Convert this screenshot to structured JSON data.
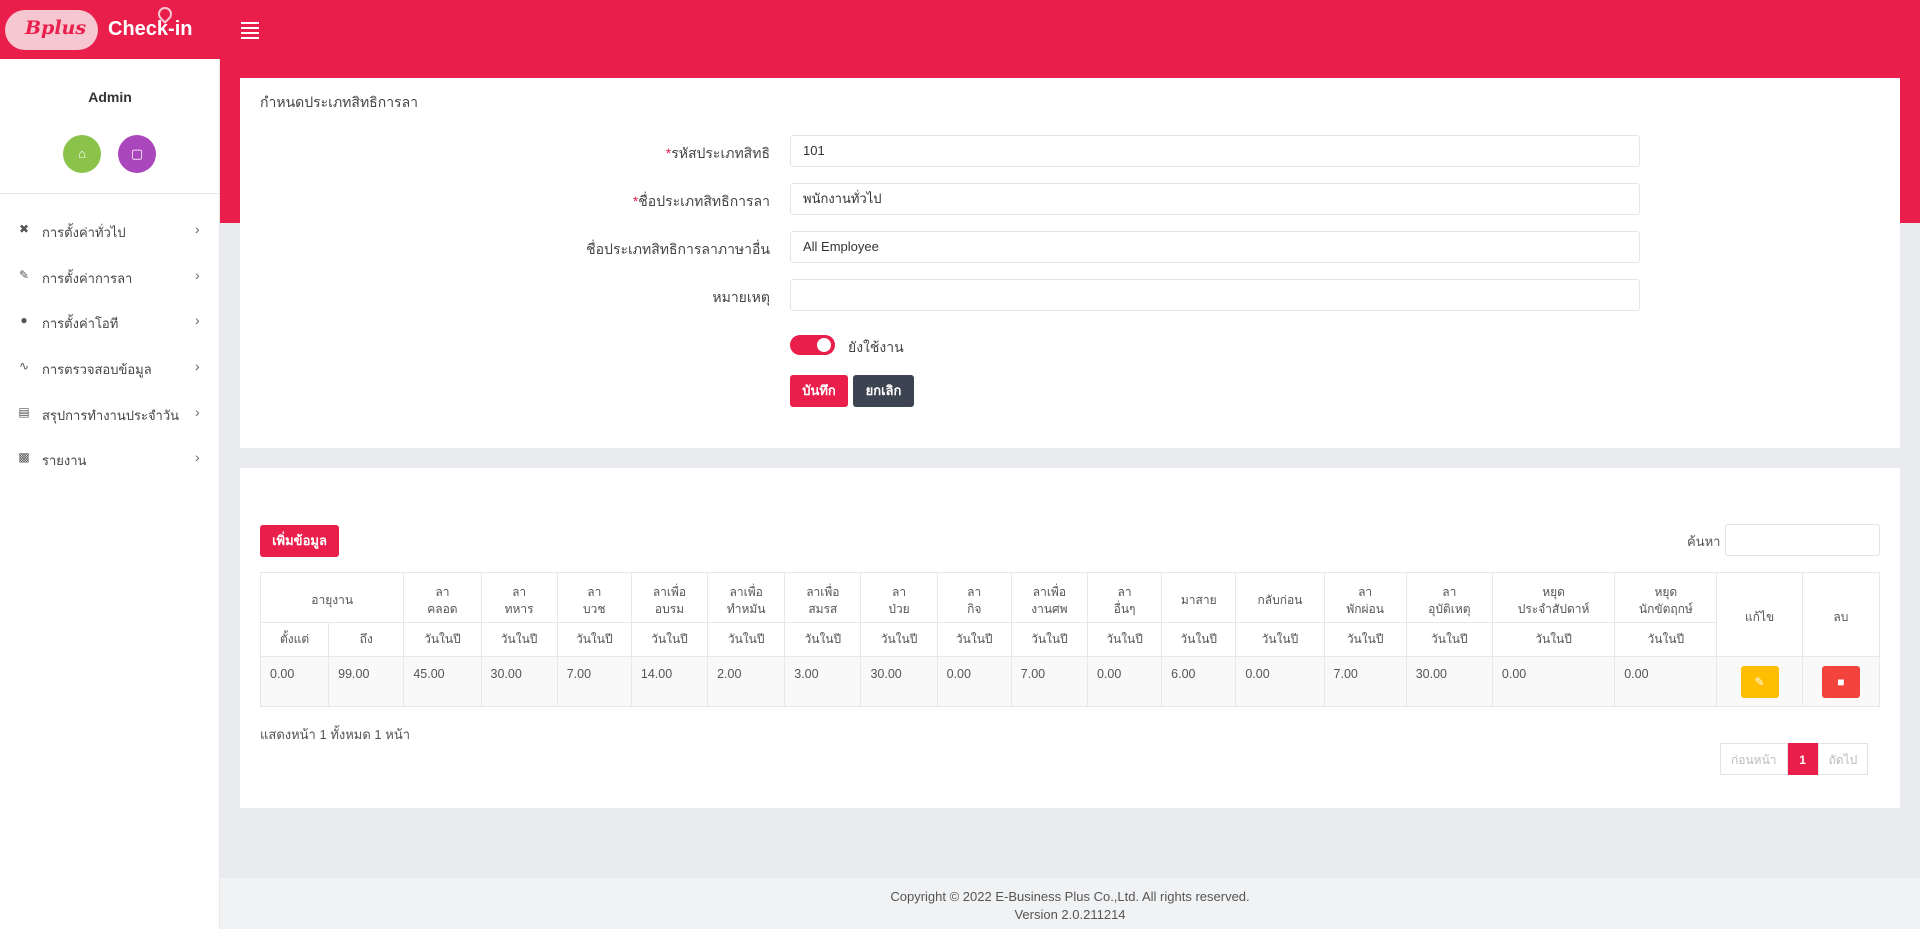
{
  "brand": {
    "logo_text": "Bplus",
    "app_name": "Check-in"
  },
  "user": {
    "name": "Admin"
  },
  "colors": {
    "primary": "#e91e4b",
    "dark": "#3d4451",
    "home": "#8bc34a",
    "lock": "#ab47bc",
    "edit": "#ffbe00",
    "delete": "#f4433c"
  },
  "sidebar": {
    "items": [
      {
        "label": "การตั้งค่าทั่วไป",
        "icon": "tools-icon"
      },
      {
        "label": "การตั้งค่าการลา",
        "icon": "edit-icon"
      },
      {
        "label": "การตั้งค่าโอที",
        "icon": "info-icon"
      },
      {
        "label": "การตรวจสอบข้อมูล",
        "icon": "pulse-icon"
      },
      {
        "label": "สรุปการทำงานประจำวัน",
        "icon": "list-icon"
      },
      {
        "label": "รายงาน",
        "icon": "document-icon"
      }
    ]
  },
  "form": {
    "title": "กำหนดประเภทสิทธิการลา",
    "code_label": "รหัสประเภทสิทธิ",
    "code_value": "101",
    "name_label": "ชื่อประเภทสิทธิการลา",
    "name_value": "พนักงานทั่วไป",
    "other_lang_label": "ชื่อประเภทสิทธิการลาภาษาอื่น",
    "other_lang_value": "All Employee",
    "remark_label": "หมายเหตุ",
    "remark_value": "",
    "active_label": "ยังใช้งาน",
    "save_label": "บันทึก",
    "cancel_label": "ยกเลิก"
  },
  "list": {
    "add_label": "เพิ่มข้อมูล",
    "search_label": "ค้นหา",
    "search_value": "",
    "headers_top": [
      "อายุงาน",
      "ลา\nคลอด",
      "ลา\nทหาร",
      "ลา\nบวช",
      "ลาเพื่อ\nอบรม",
      "ลาเพื่อ\nทำหมัน",
      "ลาเพื่อ\nสมรส",
      "ลา\nป่วย",
      "ลา\nกิจ",
      "ลาเพื่อ\nงานศพ",
      "ลา\nอื่นๆ",
      "มาสาย",
      "กลับก่อน",
      "ลา\nพักผ่อน",
      "ลา\nอุบัติเหตุ",
      "หยุด\nประจำสัปดาห์",
      "หยุด\nนักขัตฤกษ์",
      "แก้ไข",
      "ลบ"
    ],
    "headers_sub": [
      "ตั้งแต่",
      "ถึง",
      "วันในปี",
      "วันในปี",
      "วันในปี",
      "วันในปี",
      "วันในปี",
      "วันในปี",
      "วันในปี",
      "วันในปี",
      "วันในปี",
      "วันในปี",
      "วันในปี",
      "วันในปี",
      "วันในปี",
      "วันในปี",
      "วันในปี",
      "วันในปี"
    ],
    "rows": [
      [
        "0.00",
        "99.00",
        "45.00",
        "30.00",
        "7.00",
        "14.00",
        "2.00",
        "3.00",
        "30.00",
        "0.00",
        "7.00",
        "0.00",
        "6.00",
        "0.00",
        "7.00",
        "30.00",
        "0.00",
        "0.00"
      ]
    ],
    "page_info": "แสดงหน้า 1 ทั้งหมด 1 หน้า",
    "pager": {
      "prev": "ก่อนหน้า",
      "current": "1",
      "next": "ถัดไป"
    }
  },
  "footer": {
    "copyright": "Copyright © 2022 E-Business Plus Co.,Ltd. All rights reserved.",
    "version": "Version 2.0.211214"
  }
}
